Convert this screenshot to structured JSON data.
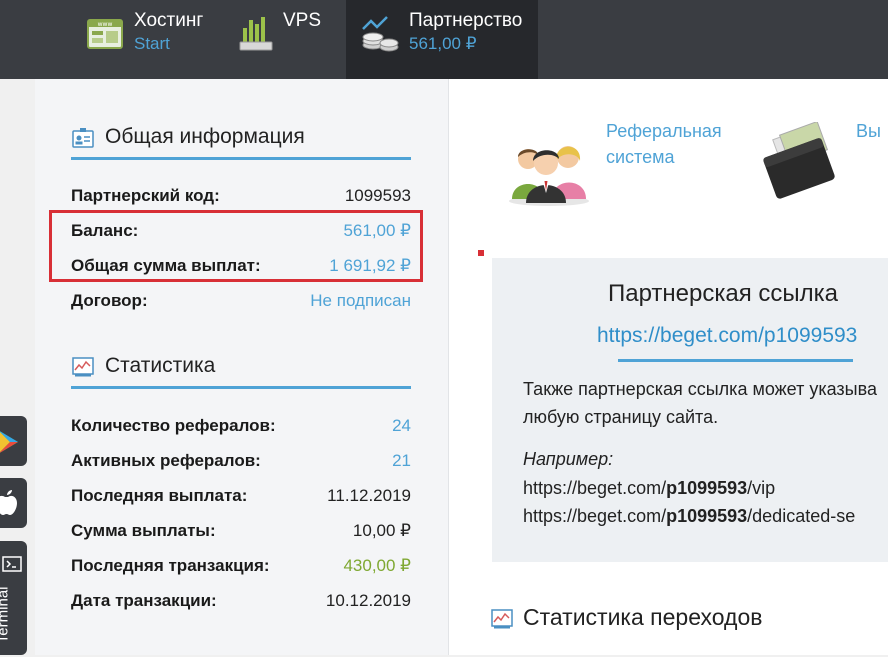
{
  "nav": {
    "hosting": {
      "title": "Хостинг",
      "sub": "Start"
    },
    "vps": {
      "title": "VPS"
    },
    "partner": {
      "title": "Партнерство",
      "sub": "561,00 ₽"
    }
  },
  "dock": {
    "terminal_label": "Terminal"
  },
  "general": {
    "heading": "Общая информация",
    "rows": [
      {
        "label": "Партнерский код:",
        "value": "1099593"
      },
      {
        "label": "Баланс:",
        "value": "561,00 ₽"
      },
      {
        "label": "Общая сумма выплат:",
        "value": "1 691,92 ₽"
      },
      {
        "label": "Договор:",
        "value": "Не подписан"
      }
    ]
  },
  "stats": {
    "heading": "Статистика",
    "rows": [
      {
        "label": "Количество рефералов:",
        "value": "24"
      },
      {
        "label": "Активных рефералов:",
        "value": "21"
      },
      {
        "label": "Последняя выплата:",
        "value": "11.12.2019"
      },
      {
        "label": "Сумма выплаты:",
        "value": "10,00 ₽"
      },
      {
        "label": "Последняя транзакция:",
        "value": "430,00 ₽"
      },
      {
        "label": "Дата транзакции:",
        "value": "10.12.2019"
      }
    ]
  },
  "promo": {
    "referral_line1": "Реферальная",
    "referral_line2": "система",
    "payout_partial": "Вы"
  },
  "link_card": {
    "title": "Партнерская ссылка",
    "url": "https://beget.com/p1099593",
    "desc_line1": "Также партнерская ссылка может указыва",
    "desc_line2": "любую страницу сайта.",
    "example_label": "Например:",
    "ex1_prefix": "https://beget.com/",
    "ex1_code": "p1099593",
    "ex1_suffix": "/vip",
    "ex2_prefix": "https://beget.com/",
    "ex2_code": "p1099593",
    "ex2_suffix": "/dedicated-se"
  },
  "transitions": {
    "heading": "Статистика переходов"
  },
  "colors": {
    "accent": "#4fa3d6",
    "highlight": "#d82f36",
    "green": "#7fa832",
    "topbar": "#3a3d42"
  }
}
